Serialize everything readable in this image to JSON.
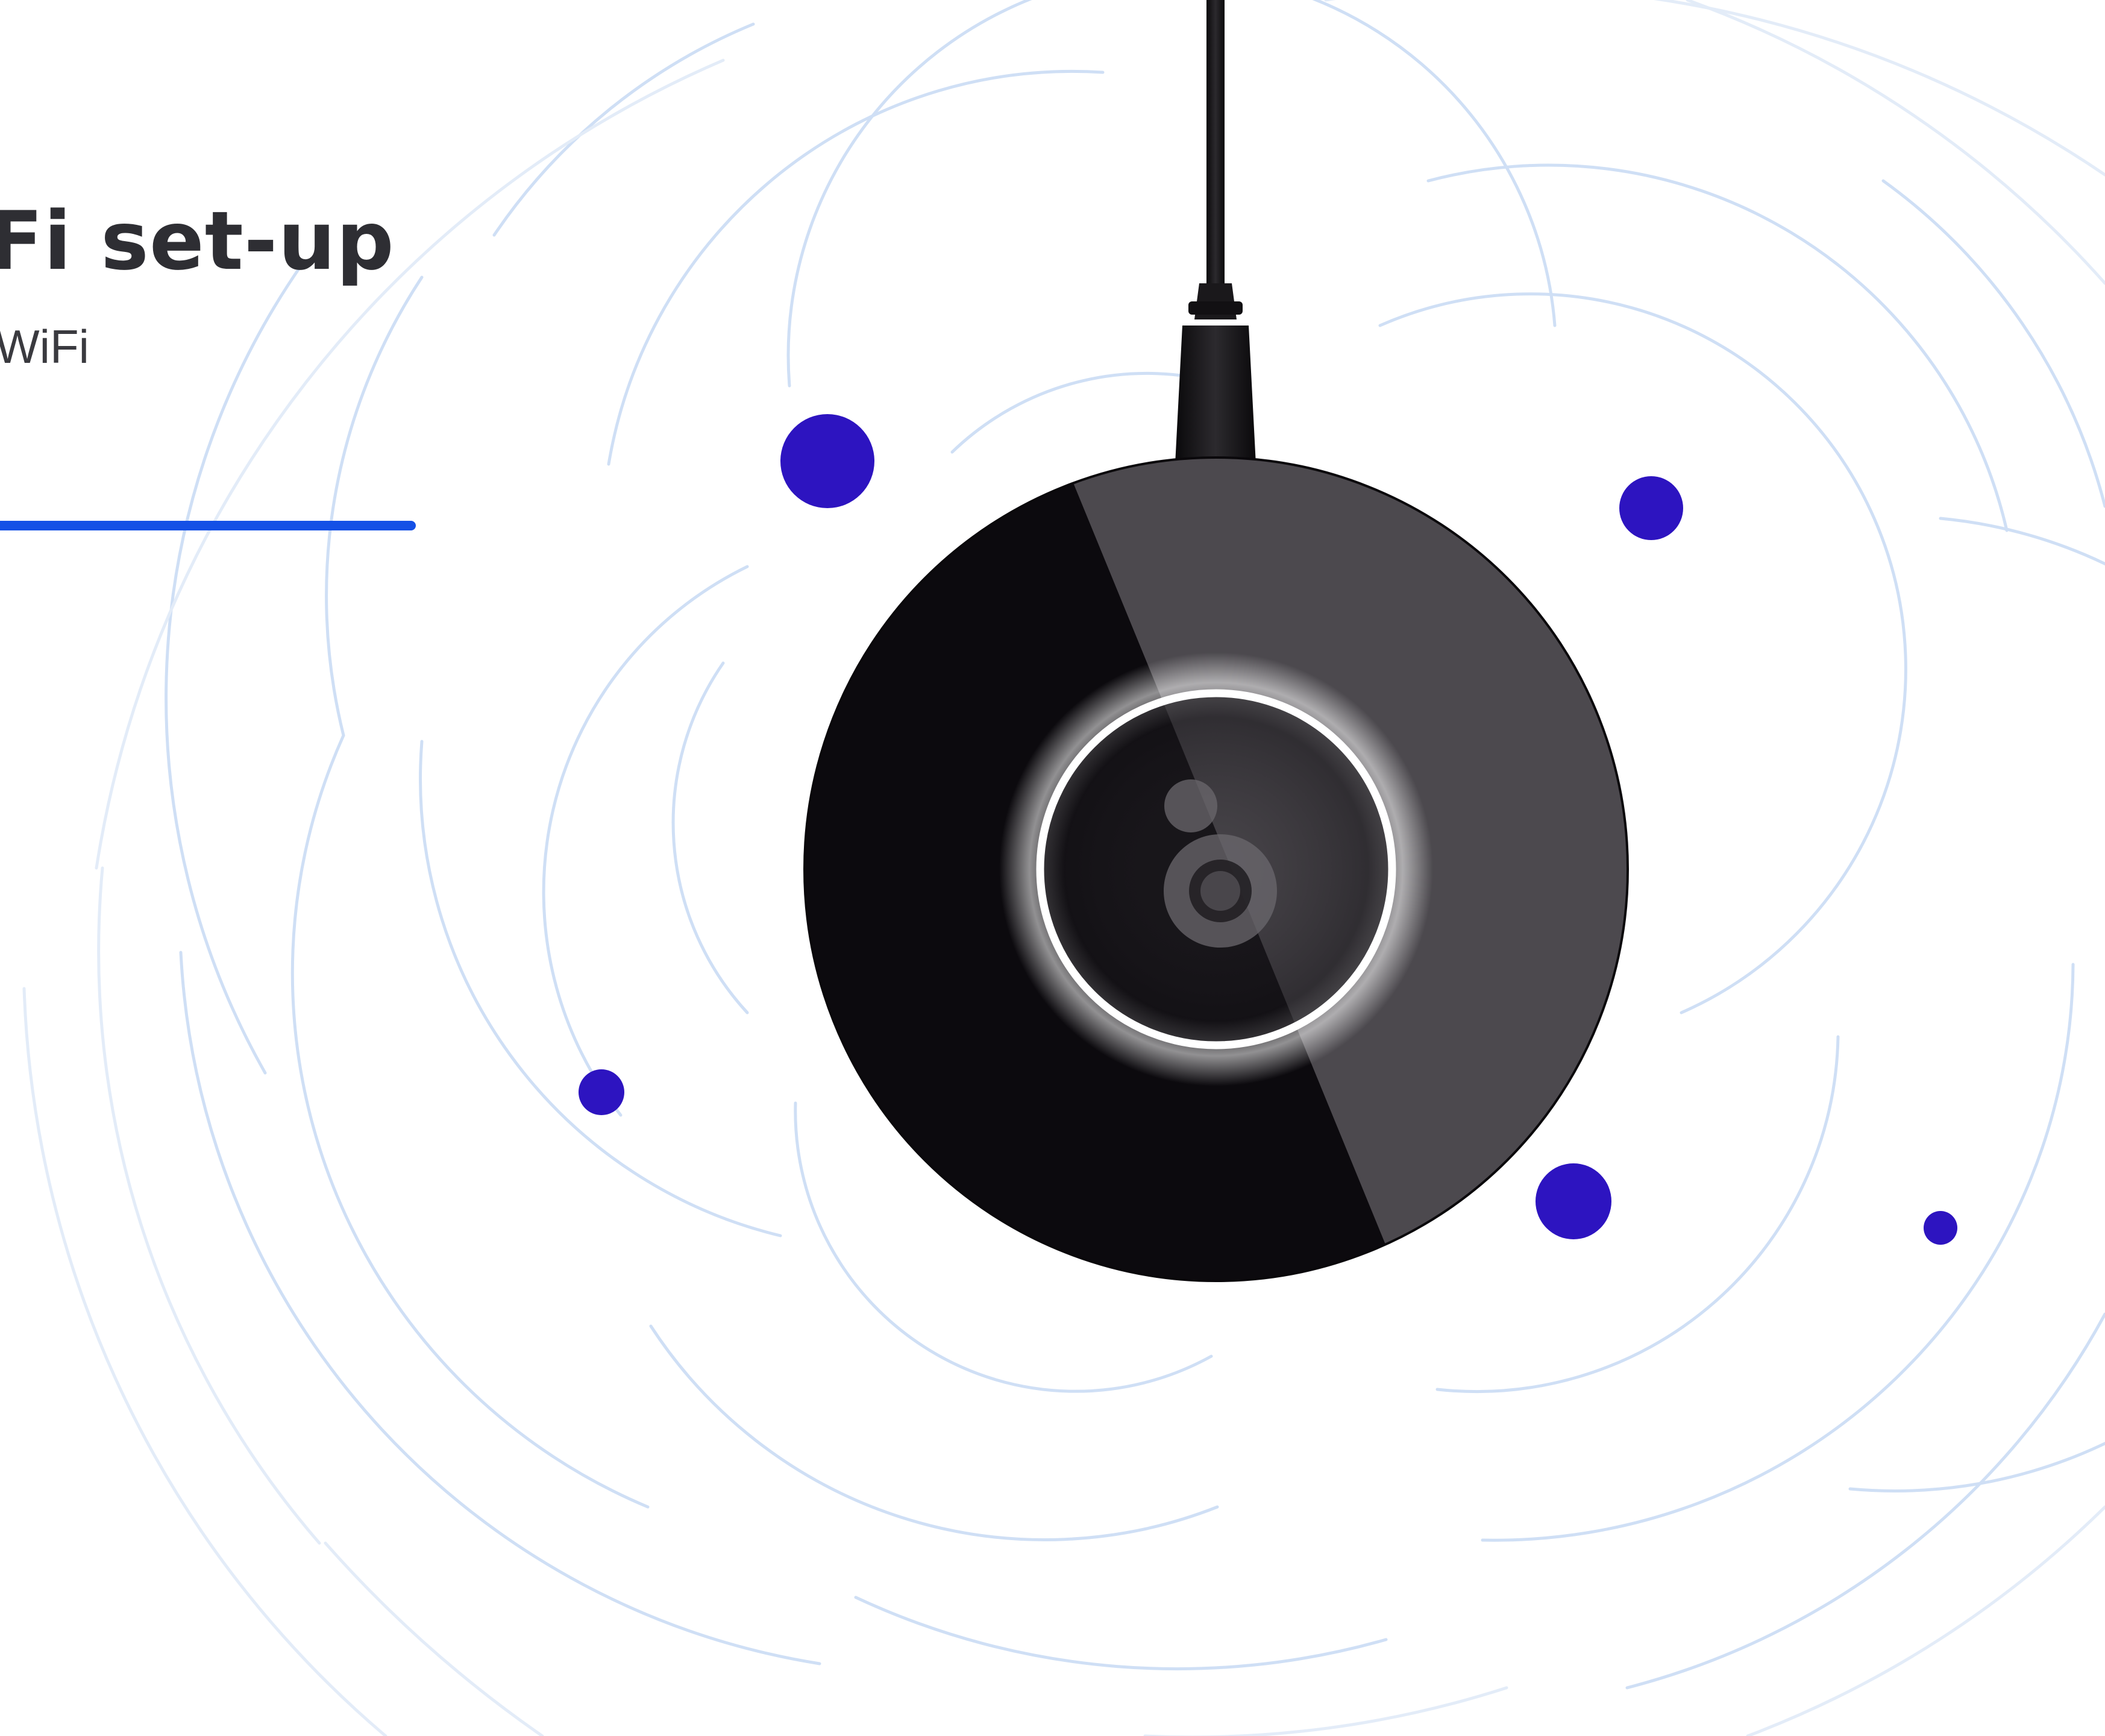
{
  "header": {
    "title": "Fi set-up",
    "subtitle": "WiFi"
  },
  "progress": {
    "fraction": 1.0
  },
  "device": {
    "icon": "hub-logo-icon",
    "ring_color": "#ffffff"
  },
  "colors": {
    "accent": "#1450e6",
    "dot": "#2d14c0",
    "ring_lines": "#cfdff5",
    "device_dark": "#0c0a0e",
    "device_light": "#4c494e",
    "text": "#2e2e33"
  }
}
